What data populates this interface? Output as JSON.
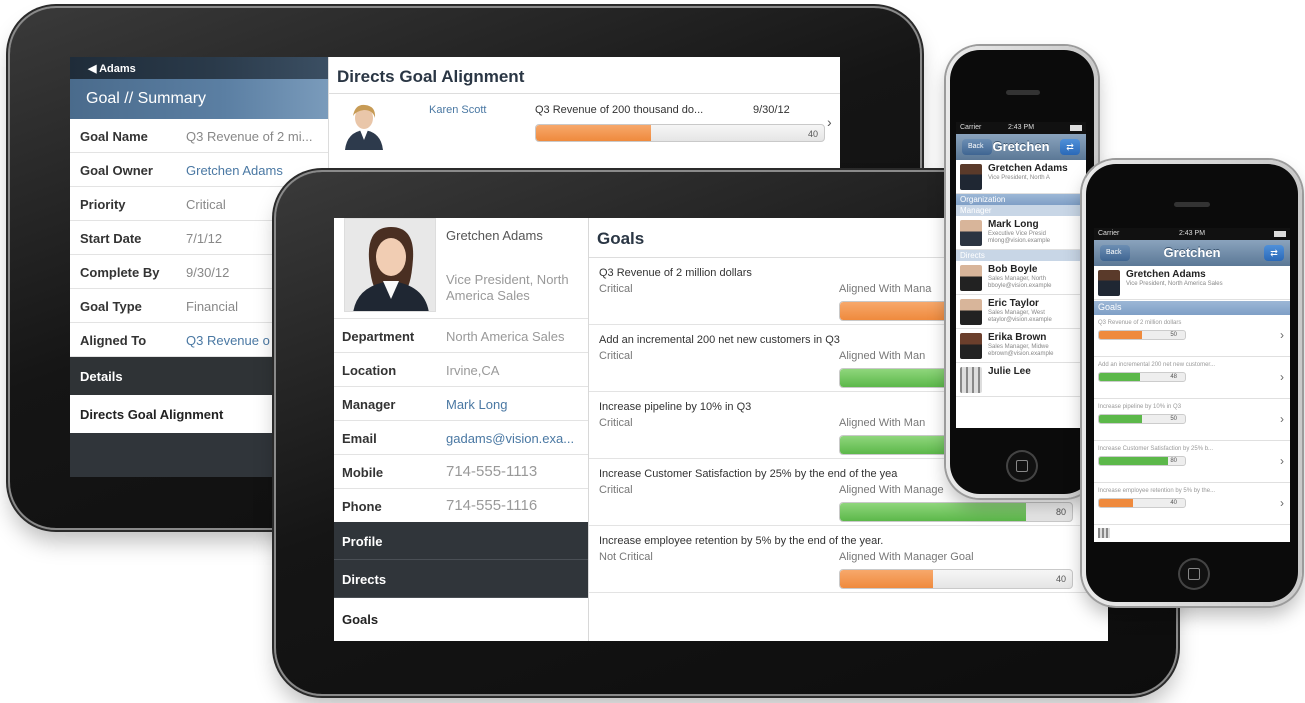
{
  "tablet_back": {
    "back_label": "Adams",
    "summary_header": "Goal // Summary",
    "fields": [
      {
        "label": "Goal Name",
        "value": "Q3 Revenue of 2 mi..."
      },
      {
        "label": "Goal Owner",
        "value": "Gretchen Adams"
      },
      {
        "label": "Priority",
        "value": "Critical"
      },
      {
        "label": "Start Date",
        "value": "7/1/12"
      },
      {
        "label": "Complete By",
        "value": "9/30/12"
      },
      {
        "label": "Goal Type",
        "value": "Financial"
      },
      {
        "label": "Aligned To",
        "value": "Q3 Revenue o"
      }
    ],
    "details_tab": "Details",
    "directs_tab": "Directs Goal Alignment",
    "right_title": "Directs Goal Alignment",
    "direct": {
      "name": "Karen Scott",
      "goal": "Q3 Revenue of 200 thousand do...",
      "date": "9/30/12",
      "progress": 40,
      "progress_label": "40"
    }
  },
  "tablet_front": {
    "profile": {
      "name": "Gretchen Adams",
      "title": "Vice President, North America Sales"
    },
    "fields": [
      {
        "label": "Department",
        "value": "North America Sales"
      },
      {
        "label": "Location",
        "value": "Irvine,CA"
      },
      {
        "label": "Manager",
        "value": "Mark Long"
      },
      {
        "label": "Email",
        "value": "gadams@vision.exa..."
      },
      {
        "label": "Mobile",
        "value": "714-555-1113"
      },
      {
        "label": "Phone",
        "value": "714-555-1116"
      }
    ],
    "nav": {
      "profile": "Profile",
      "directs": "Directs",
      "goals": "Goals"
    },
    "goals_title": "Goals",
    "goals": [
      {
        "name": "Q3 Revenue of 2 million dollars",
        "priority": "Critical",
        "alignment": "Aligned With Mana",
        "progress": 50,
        "progress_label": "",
        "color": "orange"
      },
      {
        "name": "Add an incremental 200 net new customers in Q3",
        "priority": "Critical",
        "alignment": "Aligned With Man",
        "progress": 48,
        "progress_label": "",
        "color": "green"
      },
      {
        "name": "Increase pipeline by 10% in Q3",
        "priority": "Critical",
        "alignment": "Aligned With Man",
        "progress": 50,
        "progress_label": "",
        "color": "green"
      },
      {
        "name": "Increase Customer Satisfaction by 25% by the end of the yea",
        "priority": "Critical",
        "alignment": "Aligned With Manage",
        "progress": 80,
        "progress_label": "80",
        "color": "green"
      },
      {
        "name": "Increase employee retention by 5% by the end of the year.",
        "priority": "Not Critical",
        "alignment": "Aligned With Manager Goal",
        "progress": 40,
        "progress_label": "40",
        "color": "orange"
      }
    ]
  },
  "phone_back": {
    "status": {
      "carrier": "Carrier",
      "time": "2:43 PM"
    },
    "back_label": "Back",
    "title": "Gretchen",
    "person": {
      "name": "Gretchen Adams",
      "sub": "Vice President, North A"
    },
    "section_org": "Organization",
    "section_manager": "Manager",
    "manager": {
      "name": "Mark Long",
      "sub1": "Executive Vice Presid",
      "sub2": "mlong@vision.example"
    },
    "section_directs": "Directs",
    "directs": [
      {
        "name": "Bob Boyle",
        "sub1": "Sales Manager, North",
        "sub2": "bboyle@vision.example"
      },
      {
        "name": "Eric Taylor",
        "sub1": "Sales Manager, West",
        "sub2": "etaylor@vision.example"
      },
      {
        "name": "Erika Brown",
        "sub1": "Sales Manager, Midwe",
        "sub2": "ebrown@vision.example"
      },
      {
        "name": "Julie Lee",
        "sub1": "",
        "sub2": ""
      }
    ]
  },
  "phone_front": {
    "status": {
      "carrier": "Carrier",
      "time": "2:43 PM"
    },
    "back_label": "Back",
    "title": "Gretchen",
    "person": {
      "name": "Gretchen Adams",
      "sub": "Vice President, North America Sales"
    },
    "section_goals": "Goals",
    "goals": [
      {
        "name": "Q3 Revenue of 2 million dollars",
        "progress": 50,
        "label": "50",
        "color": "orange"
      },
      {
        "name": "Add an incremental 200 net new customer...",
        "progress": 48,
        "label": "48",
        "color": "green"
      },
      {
        "name": "Increase pipeline by 10% in Q3",
        "progress": 50,
        "label": "50",
        "color": "green"
      },
      {
        "name": "Increase Customer Satisfaction by 25% b...",
        "progress": 80,
        "label": "80",
        "color": "green"
      },
      {
        "name": "Increase employee retention by 5% by the...",
        "progress": 40,
        "label": "40",
        "color": "orange"
      }
    ]
  },
  "colors": {
    "orange": "#ef8a3d",
    "green": "#5cb84a",
    "nav_dark": "#30353a",
    "link": "#4a78a3"
  }
}
